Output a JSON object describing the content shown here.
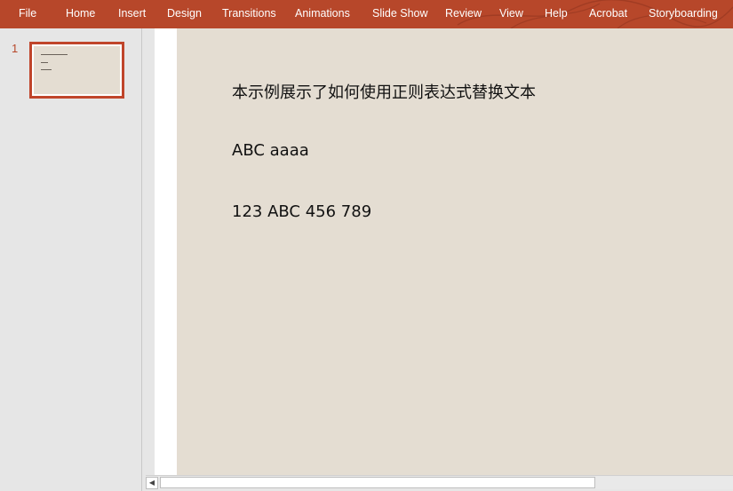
{
  "ribbon": {
    "color": "#b7472a",
    "tabs": [
      {
        "label": "File"
      },
      {
        "label": "Home"
      },
      {
        "label": "Insert"
      },
      {
        "label": "Design"
      },
      {
        "label": "Transitions"
      },
      {
        "label": "Animations"
      },
      {
        "label": "Slide Show"
      },
      {
        "label": "Review"
      },
      {
        "label": "View"
      },
      {
        "label": "Help"
      },
      {
        "label": "Acrobat"
      },
      {
        "label": "Storyboarding"
      }
    ]
  },
  "thumbnails": {
    "items": [
      {
        "number": "1"
      }
    ]
  },
  "slide": {
    "background": "#e4ddd2",
    "lines": [
      "本示例展示了如何使用正则表达式替换文本",
      "ABC aaaa",
      "123 ABC 456 789"
    ]
  },
  "scrollbar": {
    "left_arrow_icon": "chevron-left-icon"
  }
}
